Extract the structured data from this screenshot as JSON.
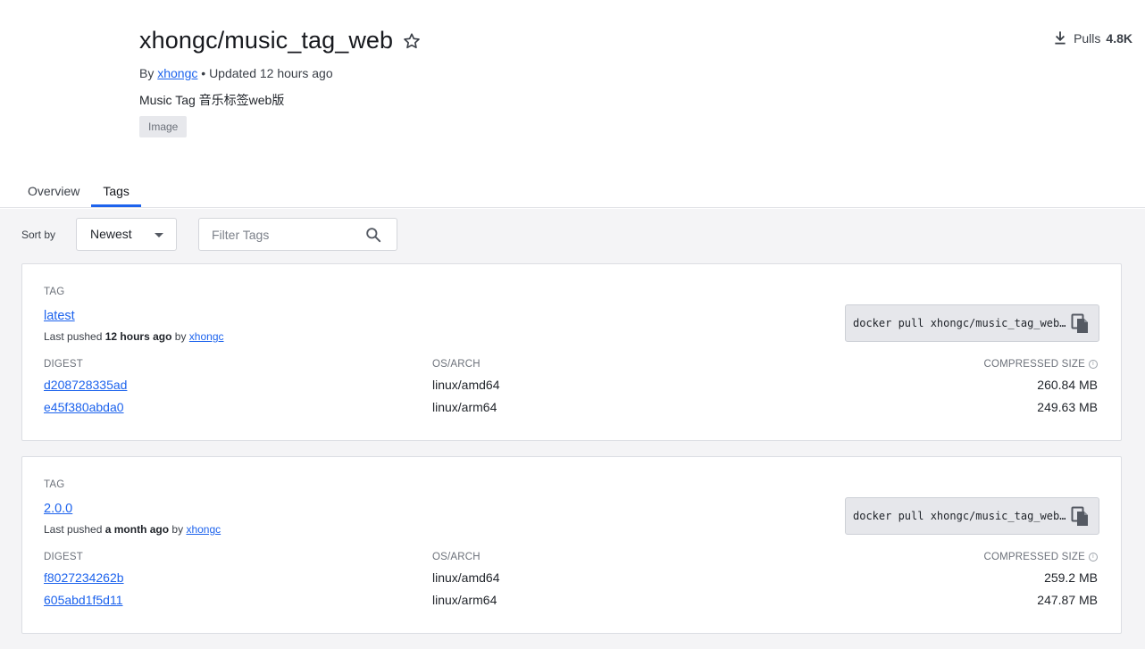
{
  "repo": {
    "title": "xhongc/music_tag_web",
    "by_label": "By",
    "owner": "xhongc",
    "updated": "• Updated 12 hours ago",
    "description": "Music Tag 音乐标签web版",
    "badge": "Image",
    "pulls_label": "Pulls",
    "pulls_count": "4.8K"
  },
  "tabs": [
    {
      "label": "Overview",
      "active": false
    },
    {
      "label": "Tags",
      "active": true
    }
  ],
  "toolbar": {
    "sort_label": "Sort by",
    "sort_value": "Newest",
    "filter_placeholder": "Filter Tags"
  },
  "columns": {
    "tag": "TAG",
    "digest": "DIGEST",
    "os_arch": "OS/ARCH",
    "compressed_size": "COMPRESSED SIZE"
  },
  "tags": [
    {
      "name": "latest",
      "pushed_prefix": "Last pushed",
      "pushed_when": "12 hours ago",
      "pushed_by_label": "by",
      "pushed_by": "xhongc",
      "pull_command": "docker pull xhongc/music_tag_web…",
      "images": [
        {
          "digest": "d208728335ad",
          "os_arch": "linux/amd64",
          "size": "260.84 MB"
        },
        {
          "digest": "e45f380abda0",
          "os_arch": "linux/arm64",
          "size": "249.63 MB"
        }
      ]
    },
    {
      "name": "2.0.0",
      "pushed_prefix": "Last pushed",
      "pushed_when": "a month ago",
      "pushed_by_label": "by",
      "pushed_by": "xhongc",
      "pull_command": "docker pull xhongc/music_tag_web…",
      "images": [
        {
          "digest": "f8027234262b",
          "os_arch": "linux/amd64",
          "size": "259.2 MB"
        },
        {
          "digest": "605abd1f5d11",
          "os_arch": "linux/arm64",
          "size": "247.87 MB"
        }
      ]
    }
  ],
  "colors": {
    "accent": "#1d63ed",
    "page_bg": "#f4f4f6",
    "card_bg": "#ffffff",
    "command_bg": "#e6e7eb"
  },
  "icons": [
    "star-icon",
    "download-icon",
    "caret-down-icon",
    "search-icon",
    "copy-icon",
    "info-icon"
  ]
}
